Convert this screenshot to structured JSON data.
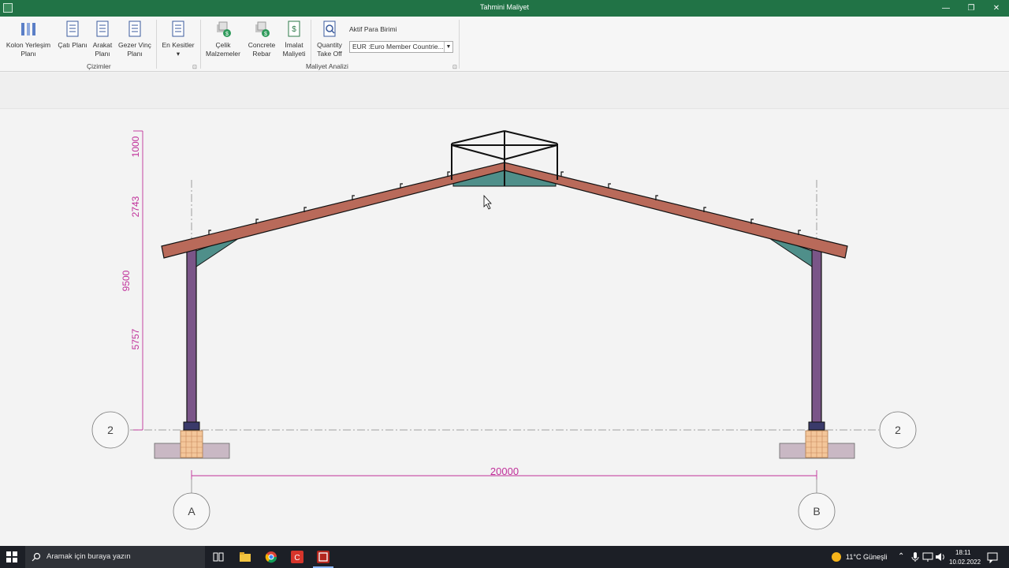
{
  "window": {
    "title": "Tahmini Maliyet",
    "controls": {
      "minimize": "—",
      "restore": "❐",
      "close": "✕"
    }
  },
  "ribbon": {
    "cizimler": {
      "label": "Çizimler",
      "buttons": [
        {
          "l1": "Kolon Yerleşim",
          "l2": "Planı"
        },
        {
          "l1": "Çatı Planı",
          "l2": ""
        },
        {
          "l1": "Arakat",
          "l2": "Planı"
        },
        {
          "l1": "Gezer Vinç",
          "l2": "Planı"
        },
        {
          "l1": "En Kesitler",
          "l2": "▾"
        }
      ]
    },
    "maliyet": {
      "label": "Maliyet Analizi",
      "buttons": [
        {
          "l1": "Çelik",
          "l2": "Malzemeler"
        },
        {
          "l1": "Concrete",
          "l2": "Rebar"
        },
        {
          "l1": "İmalat",
          "l2": "Maliyeti"
        },
        {
          "l1": "Quantity",
          "l2": "Take Off"
        }
      ],
      "currency_label": "Aktif Para Birimi",
      "currency_value": "EUR :Euro Member Countrie..."
    },
    "launcher_glyph": "⊡"
  },
  "drawing": {
    "dims_vertical": {
      "d1": "1000",
      "d2": "2743",
      "d3": "5757",
      "total": "9500"
    },
    "dim_horizontal": "20000",
    "grid_row": "2",
    "grid_cols": [
      "A",
      "B"
    ]
  },
  "taskbar": {
    "search_placeholder": "Aramak için buraya yazın",
    "weather": "11°C  Güneşli",
    "time": "18:11",
    "date": "10.02.2022"
  }
}
